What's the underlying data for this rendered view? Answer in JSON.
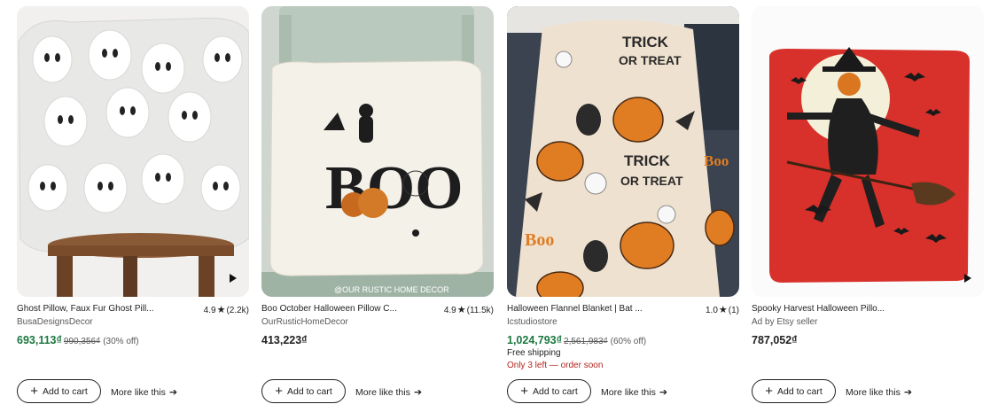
{
  "products": [
    {
      "title": "Ghost Pillow, Faux Fur Ghost Pill...",
      "rating": "4.9",
      "reviews": "(2.2k)",
      "shop": "BusaDesignsDecor",
      "price": "693,113₫",
      "original_price": "990,356₫",
      "discount": "(30% off)",
      "add_to_cart": "Add to cart",
      "more_like_this": "More like this",
      "image_icon": "ghost-pillow-image"
    },
    {
      "title": "Boo October Halloween Pillow C...",
      "rating": "4.9",
      "reviews": "(11.5k)",
      "shop": "OurRusticHomeDecor",
      "price": "413,223₫",
      "watermark": "@OUR RUSTIC HOME DECOR",
      "add_to_cart": "Add to cart",
      "more_like_this": "More like this",
      "image_icon": "boo-pillow-image"
    },
    {
      "title": "Halloween Flannel Blanket | Bat ...",
      "rating": "1.0",
      "reviews": "(1)",
      "shop": "Icstudiostore",
      "price": "1,024,793₫",
      "original_price": "2,561,983₫",
      "discount": "(60% off)",
      "shipping": "Free shipping",
      "stock": "Only 3 left — order soon",
      "blanket_text_1": "TRICK",
      "blanket_text_2": "OR TREAT",
      "blanket_text_3": "Boo",
      "add_to_cart": "Add to cart",
      "more_like_this": "More like this",
      "image_icon": "halloween-blanket-image"
    },
    {
      "title": "Spooky Harvest Halloween Pillo...",
      "shop": "Ad by Etsy seller",
      "price": "787,052₫",
      "add_to_cart": "Add to cart",
      "more_like_this": "More like this",
      "image_icon": "scarecrow-pillow-image"
    }
  ],
  "colors": {
    "sale_price": "#1b7740",
    "stock_warning": "#b3261e",
    "text": "#222222",
    "muted": "#595959"
  }
}
